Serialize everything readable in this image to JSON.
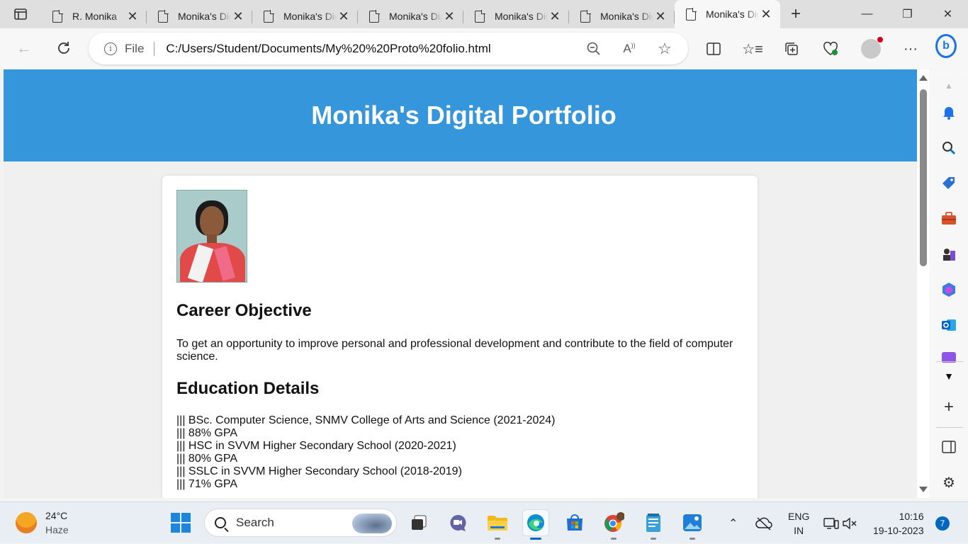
{
  "browser": {
    "tabs": [
      {
        "title": "R. Monika",
        "active": false
      },
      {
        "title": "Monika's Digital Portfolio",
        "active": false
      },
      {
        "title": "Monika's Digital Portfolio",
        "active": false
      },
      {
        "title": "Monika's Digital Portfolio",
        "active": false
      },
      {
        "title": "Monika's Digital Portfolio",
        "active": false
      },
      {
        "title": "Monika's Digital Portfolio",
        "active": false
      },
      {
        "title": "Monika's Digital Portfolio",
        "active": true
      }
    ],
    "address": {
      "scheme_label": "File",
      "url": "C:/Users/Student/Documents/My%20%20Proto%20folio.html"
    },
    "colors": {
      "accent": "#1a73e8",
      "tabstrip": "#dfdfdf"
    }
  },
  "page": {
    "header_title": "Monika's Digital Portfolio",
    "header_color": "#3596db",
    "career_heading": "Career Objective",
    "career_text": "To get an opportunity to improve personal and professional development and contribute to the field of computer science.",
    "education_heading": "Education Details",
    "education_items": [
      "||| BSc. Computer Science, SNMV College of Arts and Science (2021-2024)",
      "||| 88% GPA",
      "||| HSC in SVVM Higher Secondary School (2020-2021)",
      "||| 80% GPA",
      "||| SSLC in SVVM Higher Secondary School (2018-2019)",
      "||| 71% GPA"
    ]
  },
  "taskbar": {
    "weather_temp": "24°C",
    "weather_condition": "Haze",
    "search_label": "Search",
    "lang_line1": "ENG",
    "lang_line2": "IN",
    "time": "10:16",
    "date": "19-10-2023",
    "notification_count": "7"
  }
}
